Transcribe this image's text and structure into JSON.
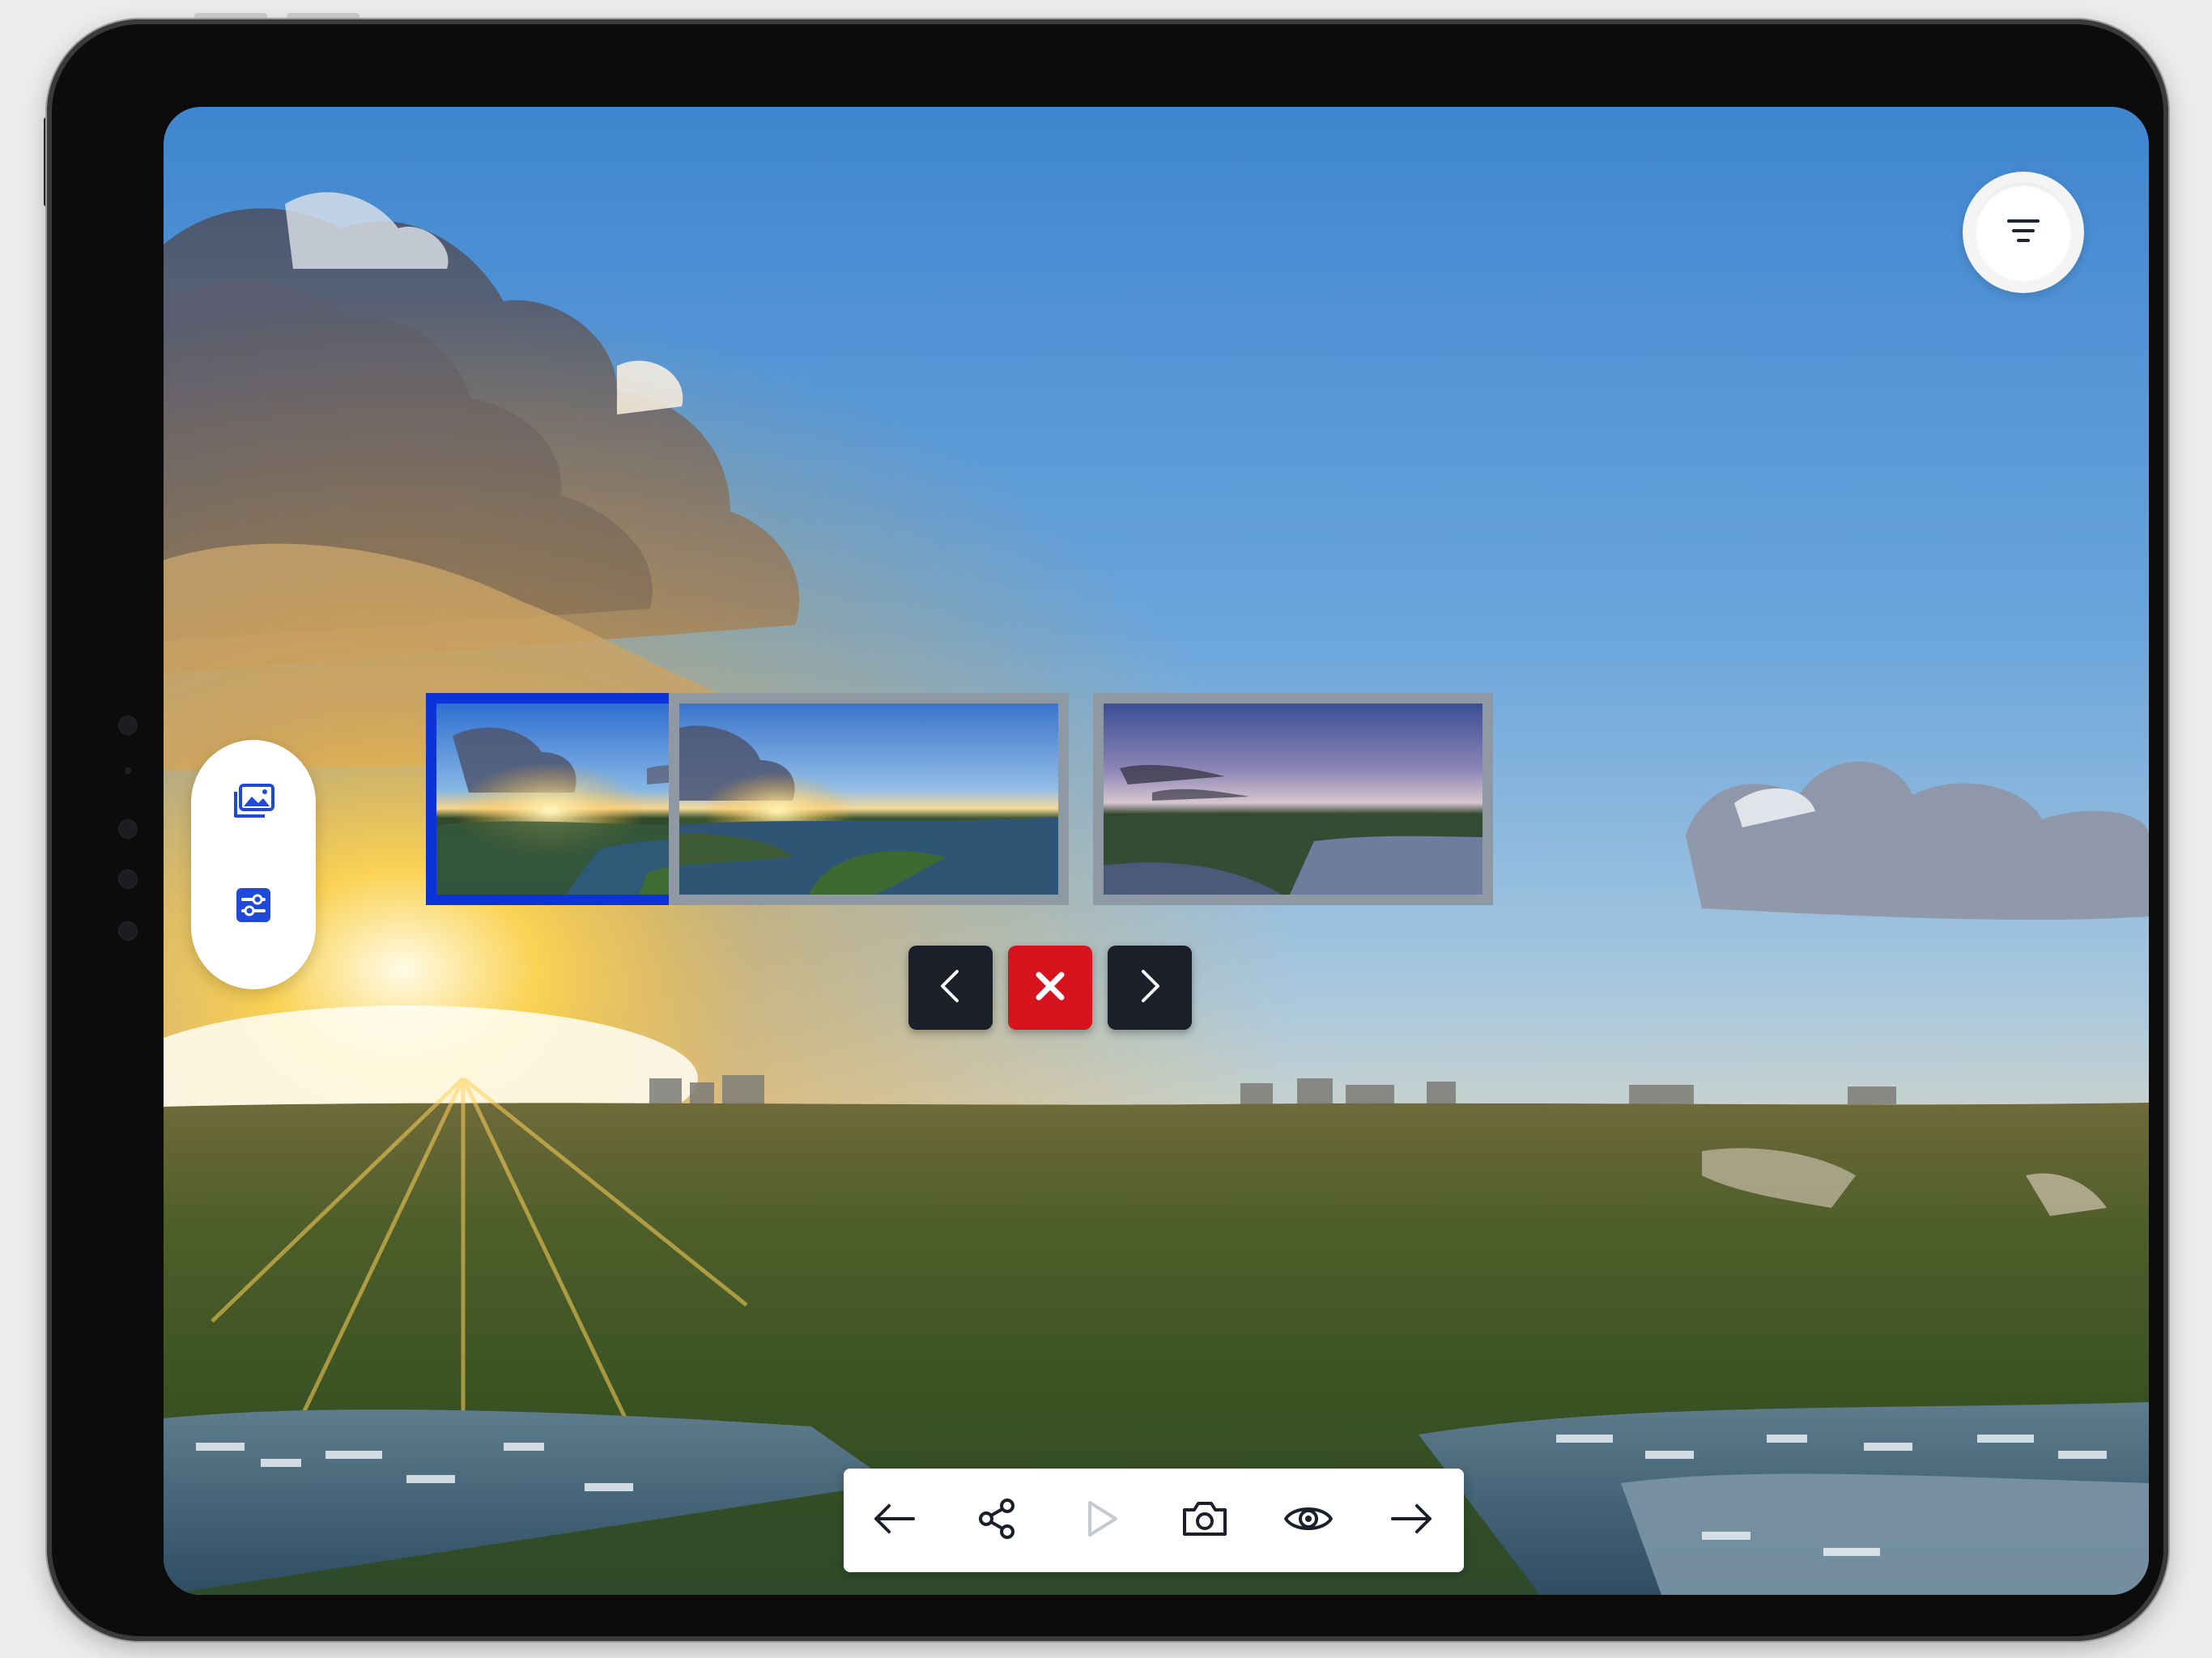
{
  "app": {
    "accent_color": "#0b33d8",
    "close_color": "#d7141e"
  },
  "filter": {
    "icon": "filter-lines-icon"
  },
  "side_panel": {
    "items": [
      {
        "icon": "gallery-icon"
      },
      {
        "icon": "settings-sliders-icon"
      }
    ]
  },
  "gallery": {
    "selected_index": 0,
    "thumbnails": [
      {
        "icon": "panorama-thumbnail-sunset",
        "selected": true
      },
      {
        "icon": "panorama-thumbnail-bay",
        "selected": false
      },
      {
        "icon": "panorama-thumbnail-dusk",
        "selected": false
      }
    ],
    "controls": [
      {
        "icon": "chevron-left-icon"
      },
      {
        "icon": "close-icon"
      },
      {
        "icon": "chevron-right-icon"
      }
    ]
  },
  "toolbar": {
    "items": [
      {
        "icon": "arrow-left-icon"
      },
      {
        "icon": "share-icon"
      },
      {
        "icon": "play-icon",
        "disabled": true
      },
      {
        "icon": "camera-icon"
      },
      {
        "icon": "eye-icon"
      },
      {
        "icon": "arrow-right-icon"
      }
    ]
  }
}
